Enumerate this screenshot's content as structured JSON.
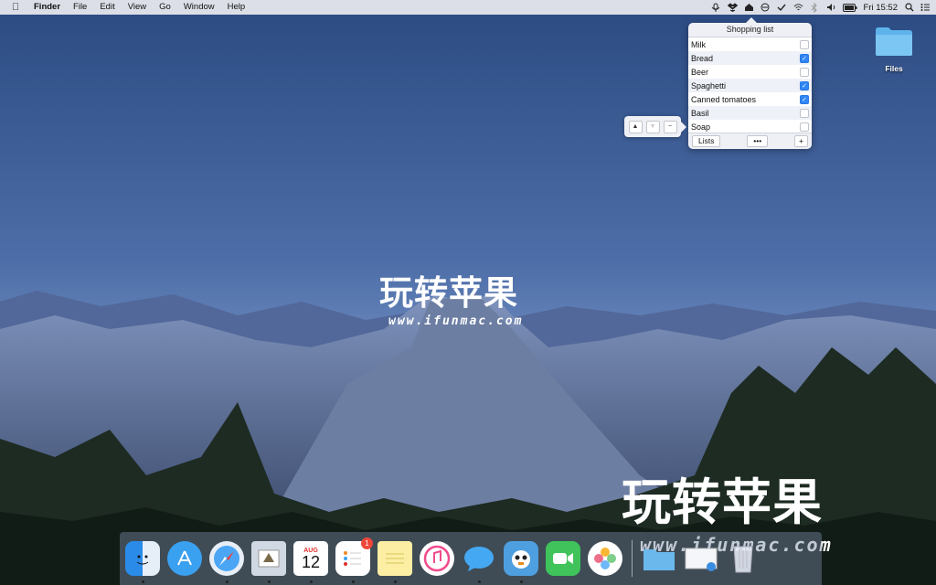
{
  "menubar": {
    "app_name": "Finder",
    "menus": [
      "File",
      "Edit",
      "View",
      "Go",
      "Window",
      "Help"
    ],
    "clock": "Fri 15:52",
    "status_icons": [
      "mic-icon",
      "dropbox-icon",
      "home-icon",
      "timer-icon",
      "checkmark-icon",
      "wifi-icon",
      "bluetooth-icon",
      "volume-icon",
      "battery-icon",
      "search-icon",
      "list-icon"
    ]
  },
  "popover": {
    "title": "Shopping list",
    "items": [
      {
        "label": "Milk",
        "checked": false
      },
      {
        "label": "Bread",
        "checked": true
      },
      {
        "label": "Beer",
        "checked": false
      },
      {
        "label": "Spaghetti",
        "checked": true
      },
      {
        "label": "Canned tomatoes",
        "checked": true
      },
      {
        "label": "Basil",
        "checked": false
      },
      {
        "label": "Soap",
        "checked": false
      }
    ],
    "lists_label": "Lists",
    "more_label": "•••",
    "add_label": "+",
    "accent_color": "#2f86f6"
  },
  "side_controls": {
    "up": "▲",
    "down": "▼",
    "remove": "−"
  },
  "desktop": {
    "folder_label": "Files"
  },
  "watermark": {
    "cn": "玩转苹果",
    "url": "www.ifunmac.com"
  },
  "dock": {
    "apps": [
      "finder-icon",
      "app-store-icon",
      "safari-icon",
      "mail-icon",
      "calendar-icon",
      "reminders-icon",
      "notes-icon",
      "itunes-icon",
      "messages-icon",
      "tweetbot-icon",
      "facetime-icon",
      "photos-icon",
      "downloads-folder-icon",
      "preview-icon",
      "trash-icon"
    ],
    "calendar_month": "AUG",
    "calendar_day": "12",
    "reminders_badge": "1"
  }
}
